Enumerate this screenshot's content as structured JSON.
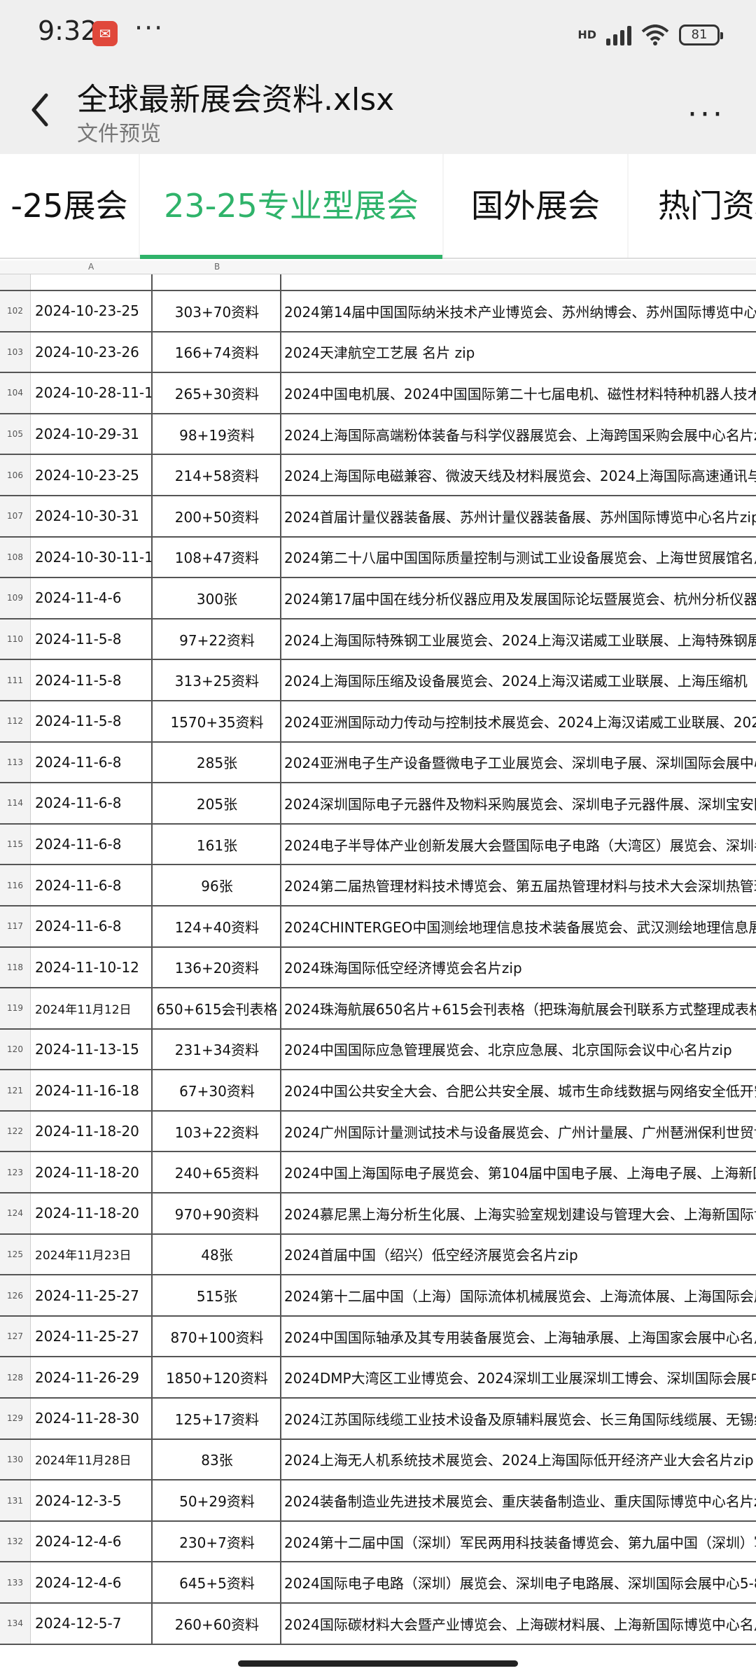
{
  "status_bar": {
    "time": "9:32",
    "app_icon": "app-notification-icon",
    "dots": "···",
    "network": "HD",
    "battery": "81"
  },
  "header": {
    "title": "全球最新展会资料.xlsx",
    "subtitle": "文件预览",
    "more": "···"
  },
  "tabs": [
    {
      "label": "-25展会"
    },
    {
      "label": "23-25专业型展会",
      "active": true
    },
    {
      "label": "国外展会"
    },
    {
      "label": "热门资料"
    }
  ],
  "sheet": {
    "columns": [
      "A",
      "B"
    ],
    "rows": [
      {
        "num": "102",
        "date": "2024-10-23-25",
        "qty": "303+70资料",
        "desc": "2024第14届中国国际纳米技术产业博览会、苏州纳博会、苏州国际博览中心名"
      },
      {
        "num": "103",
        "date": "2024-10-23-26",
        "qty": "166+74资料",
        "desc": "2024天津航空工艺展 名片 zip"
      },
      {
        "num": "104",
        "date": "2024-10-28-11-1",
        "qty": "265+30资料",
        "desc": "2024中国电机展、2024中国国际第二十七届电机、磁性材料特种机器人技术"
      },
      {
        "num": "105",
        "date": "2024-10-29-31",
        "qty": "98+19资料",
        "desc": "2024上海国际高端粉体装备与科学仪器展览会、上海跨国采购会展中心名片z"
      },
      {
        "num": "106",
        "date": "2024-10-23-25",
        "qty": "214+58资料",
        "desc": "2024上海国际电磁兼容、微波天线及材料展览会、2024上海国际高速通讯与"
      },
      {
        "num": "107",
        "date": "2024-10-30-31",
        "qty": "200+50资料",
        "desc": "2024首届计量仪器装备展、苏州计量仪器装备展、苏州国际博览中心名片zip"
      },
      {
        "num": "108",
        "date": "2024-10-30-11-1",
        "qty": "108+47资料",
        "desc": "2024第二十八届中国国际质量控制与测试工业设备展览会、上海世贸展馆名片"
      },
      {
        "num": "109",
        "date": "2024-11-4-6",
        "qty": "300张",
        "desc": "2024第17届中国在线分析仪器应用及发展国际论坛暨展览会、杭州分析仪器展"
      },
      {
        "num": "110",
        "date": "2024-11-5-8",
        "qty": "97+22资料",
        "desc": "2024上海国际特殊钢工业展览会、2024上海汉诺威工业联展、上海特殊钢展"
      },
      {
        "num": "111",
        "date": "2024-11-5-8",
        "qty": "313+25资料",
        "desc": "2024上海国际压缩及设备展览会、2024上海汉诺威工业联展、上海压缩机"
      },
      {
        "num": "112",
        "date": "2024-11-5-8",
        "qty": "1570+35资料",
        "desc": "2024亚洲国际动力传动与控制技术展览会、2024上海汉诺威工业联展、2024"
      },
      {
        "num": "113",
        "date": "2024-11-6-8",
        "qty": "285张",
        "desc": "2024亚洲电子生产设备暨微电子工业展览会、深圳电子展、深圳国际会展中心"
      },
      {
        "num": "114",
        "date": "2024-11-6-8",
        "qty": "205张",
        "desc": "2024深圳国际电子元器件及物料采购展览会、深圳电子元器件展、深圳宝安国"
      },
      {
        "num": "115",
        "date": "2024-11-6-8",
        "qty": "161张",
        "desc": "2024电子半导体产业创新发展大会暨国际电子电路（大湾区）展览会、深圳半"
      },
      {
        "num": "116",
        "date": "2024-11-6-8",
        "qty": "96张",
        "desc": "2024第二届热管理材料技术博览会、第五届热管理材料与技术大会深圳热管理"
      },
      {
        "num": "117",
        "date": "2024-11-6-8",
        "qty": "124+40资料",
        "desc": "2024CHINTERGEO中国测绘地理信息技术装备展览会、武汉测绘地理信息展"
      },
      {
        "num": "118",
        "date": "2024-11-10-12",
        "qty": "136+20资料",
        "desc": "2024珠海国际低空经济博览会名片zip"
      },
      {
        "num": "119",
        "date": "2024年11月12日",
        "qty": "650+615会刊表格",
        "desc": "2024珠海航展650名片+615会刊表格（把珠海航展会刊联系方式整理成表格形"
      },
      {
        "num": "120",
        "date": "2024-11-13-15",
        "qty": "231+34资料",
        "desc": "2024中国国际应急管理展览会、北京应急展、北京国际会议中心名片zip"
      },
      {
        "num": "121",
        "date": "2024-11-16-18",
        "qty": "67+30资料",
        "desc": "2024中国公共安全大会、合肥公共安全展、城市生命线数据与网络安全低开安"
      },
      {
        "num": "122",
        "date": "2024-11-18-20",
        "qty": "103+22资料",
        "desc": "2024广州国际计量测试技术与设备展览会、广州计量展、广州琶洲保利世贸博"
      },
      {
        "num": "123",
        "date": "2024-11-18-20",
        "qty": "240+65资料",
        "desc": "2024中国上海国际电子展览会、第104届中国电子展、上海电子展、上海新国"
      },
      {
        "num": "124",
        "date": "2024-11-18-20",
        "qty": "970+90资料",
        "desc": "2024慕尼黑上海分析生化展、上海实验室规划建设与管理大会、上海新国际博"
      },
      {
        "num": "125",
        "date": "2024年11月23日",
        "qty": "48张",
        "desc": "2024首届中国（绍兴）低空经济展览会名片zip"
      },
      {
        "num": "126",
        "date": "2024-11-25-27",
        "qty": "515张",
        "desc": "2024第十二届中国（上海）国际流体机械展览会、上海流体展、上海国际会展"
      },
      {
        "num": "127",
        "date": "2024-11-25-27",
        "qty": "870+100资料",
        "desc": "2024中国国际轴承及其专用装备展览会、上海轴承展、上海国家会展中心名片"
      },
      {
        "num": "128",
        "date": "2024-11-26-29",
        "qty": "1850+120资料",
        "desc": "2024DMP大湾区工业博览会、2024深圳工业展深圳工博会、深圳国际会展中"
      },
      {
        "num": "129",
        "date": "2024-11-28-30",
        "qty": "125+17资料",
        "desc": "2024江苏国际线缆工业技术设备及原辅料展览会、长三角国际线缆展、无锡线"
      },
      {
        "num": "130",
        "date": "2024年11月28日",
        "qty": "83张",
        "desc": "2024上海无人机系统技术展览会、2024上海国际低开经济产业大会名片zip"
      },
      {
        "num": "131",
        "date": "2024-12-3-5",
        "qty": "50+29资料",
        "desc": "2024装备制造业先进技术展览会、重庆装备制造业、重庆国际博览中心名片z"
      },
      {
        "num": "132",
        "date": "2024-12-4-6",
        "qty": "230+7资料",
        "desc": "2024第十二届中国（深圳）军民两用科技装备博览会、第九届中国（深圳）军"
      },
      {
        "num": "133",
        "date": "2024-12-4-6",
        "qty": "645+5资料",
        "desc": "2024国际电子电路（深圳）展览会、深圳电子电路展、深圳国际会展中心5-8"
      },
      {
        "num": "134",
        "date": "2024-12-5-7",
        "qty": "260+60资料",
        "desc": "2024国际碳材料大会暨产业博览会、上海碳材料展、上海新国际博览中心名片"
      }
    ]
  }
}
